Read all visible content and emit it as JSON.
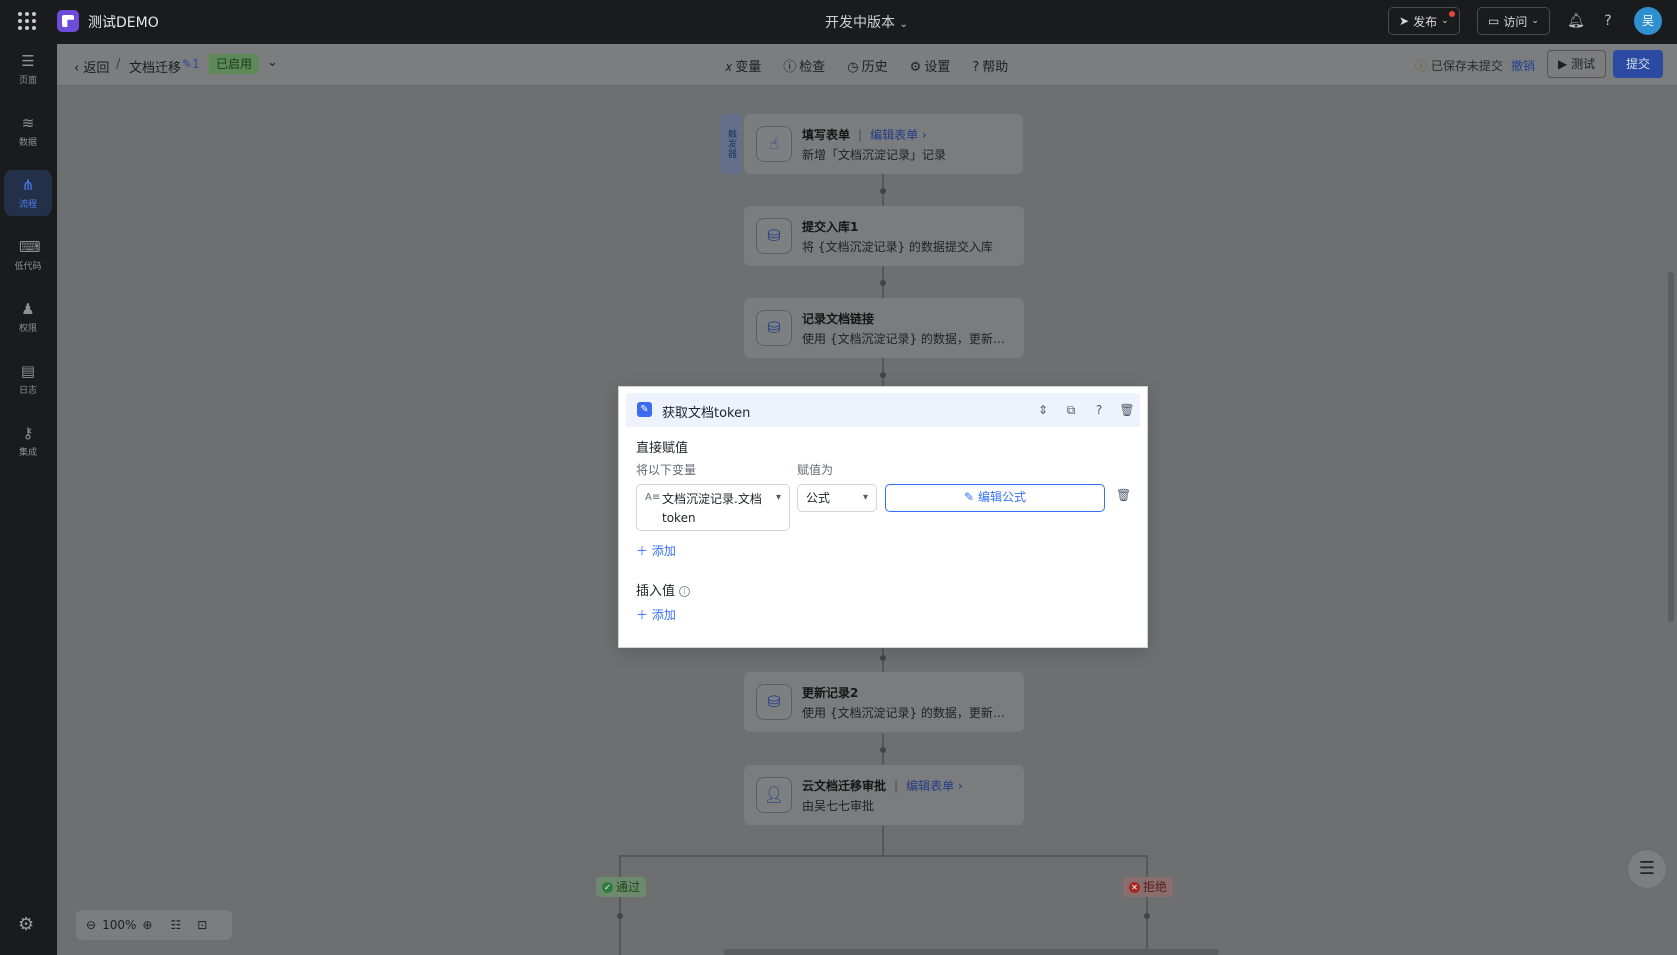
{
  "app": {
    "name": "测试DEMO",
    "version_label": "开发中版本",
    "avatar_initial": "吴"
  },
  "topbar": {
    "publish_label": "发布",
    "visit_label": "访问"
  },
  "sidebar": {
    "items": [
      {
        "label": "页面",
        "icon": "pages-icon"
      },
      {
        "label": "数据",
        "icon": "database-icon"
      },
      {
        "label": "流程",
        "icon": "flow-icon",
        "active": true
      },
      {
        "label": "低代码",
        "icon": "code-icon"
      },
      {
        "label": "权限",
        "icon": "people-icon"
      },
      {
        "label": "日志",
        "icon": "log-icon"
      },
      {
        "label": "集成",
        "icon": "key-icon"
      }
    ]
  },
  "subbar": {
    "back_label": "返回",
    "separator": "/",
    "flow_name": "文档迁移",
    "version_num": "1",
    "status": "已启用",
    "tools": [
      "变量",
      "检查",
      "历史",
      "设置",
      "帮助"
    ],
    "saved_text": "已保存未提交",
    "undo_label": "撤销",
    "test_label": "测试",
    "submit_label": "提交"
  },
  "flow": {
    "trigger_tab": "触发器",
    "nodes": [
      {
        "title": "填写表单",
        "link": "编辑表单",
        "desc": "新增「文档沉淀记录」记录"
      },
      {
        "title": "提交入库1",
        "desc": "将 {文档沉淀记录} 的数据提交入库"
      },
      {
        "title": "记录文档链接",
        "desc": "使用 {文档沉淀记录} 的数据，更新「..."
      },
      {
        "title": "更新记录2",
        "desc": "使用 {文档沉淀记录} 的数据，更新「..."
      },
      {
        "title": "云文档迁移审批",
        "link": "编辑表单",
        "desc": "由吴七七审批"
      }
    ],
    "branch_pass": "通过",
    "branch_reject": "拒绝"
  },
  "panel": {
    "title": "获取文档token",
    "section_direct": "直接赋值",
    "label_vars": "将以下变量",
    "label_assign": "赋值为",
    "var_value": "文档沉淀记录.文档token",
    "type_value": "公式",
    "formula_label": "编辑公式",
    "add_label": "添加",
    "section_insert": "插入值",
    "add_label_2": "添加"
  },
  "zoom": {
    "level": "100%"
  },
  "colors": {
    "accent": "#3370ff",
    "submit": "#2b4ba3",
    "pass": "#3fa55b",
    "reject": "#e5483e"
  }
}
